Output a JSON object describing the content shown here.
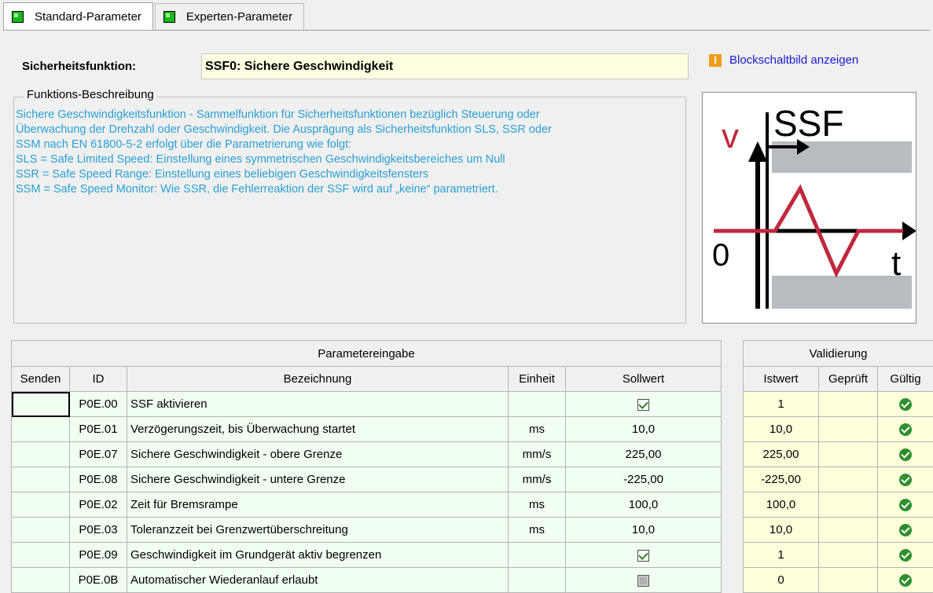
{
  "tabs": [
    {
      "label": "Standard-Parameter",
      "active": true
    },
    {
      "label": "Experten-Parameter",
      "active": false
    }
  ],
  "safety_function": {
    "label": "Sicherheitsfunktion:",
    "value": "SSF0: Sichere Geschwindigkeit"
  },
  "block_diagram_link": {
    "icon": "info-icon",
    "label": "Blockschaltbild anzeigen"
  },
  "description": {
    "legend": "Funktions-Beschreibung",
    "lines": [
      "Sichere Geschwindigkeitsfunktion - Sammelfunktion für Sicherheitsfunktionen bezüglich Steuerung oder",
      "Überwachung der Drehzahl oder Geschwindigkeit. Die Ausprägung als Sicherheitsfunktion SLS, SSR oder",
      "SSM nach EN 61800-5-2 erfolgt über die Parametrierung wie folgt:",
      "SLS = Safe Limited Speed:   Einstellung eines symmetrischen Geschwindigkeitsbereiches um Null",
      "SSR = Safe Speed Range: Einstellung eines beliebigen Geschwindigkeitsfensters",
      "SSM = Safe Speed Monitor: Wie SSR, die Fehlerreaktion der SSF wird auf „keine“ parametriert."
    ]
  },
  "diagram": {
    "title": "SSF",
    "v_label": "v",
    "zero_label": "0",
    "t_label": "t",
    "colors": {
      "signal": "#c0283c",
      "band": "#b8bcc0",
      "axis": "#000000"
    }
  },
  "table": {
    "group_input": "Parametereingabe",
    "group_validation": "Validierung",
    "columns": {
      "send": "Senden",
      "id": "ID",
      "name": "Bezeichnung",
      "unit": "Einheit",
      "setpoint": "Sollwert",
      "actual": "Istwert",
      "checked": "Geprüft",
      "valid": "Gültig"
    },
    "rows": [
      {
        "id": "P0E.00",
        "name": "SSF aktivieren",
        "unit": "",
        "setpoint": "",
        "setpoint_checkbox": "checked",
        "actual": "1",
        "valid": true
      },
      {
        "id": "P0E.01",
        "name": "Verzögerungszeit, bis Überwachung startet",
        "unit": "ms",
        "setpoint": "10,0",
        "setpoint_checkbox": "",
        "actual": "10,0",
        "valid": true
      },
      {
        "id": "P0E.07",
        "name": "Sichere Geschwindigkeit - obere Grenze",
        "unit": "mm/s",
        "setpoint": "225,00",
        "setpoint_checkbox": "",
        "actual": "225,00",
        "valid": true
      },
      {
        "id": "P0E.08",
        "name": "Sichere Geschwindigkeit - untere Grenze",
        "unit": "mm/s",
        "setpoint": "-225,00",
        "setpoint_checkbox": "",
        "actual": "-225,00",
        "valid": true
      },
      {
        "id": "P0E.02",
        "name": "Zeit für Bremsrampe",
        "unit": "ms",
        "setpoint": "100,0",
        "setpoint_checkbox": "",
        "actual": "100,0",
        "valid": true
      },
      {
        "id": "P0E.03",
        "name": "Toleranzzeit bei Grenzwertüberschreitung",
        "unit": "ms",
        "setpoint": "10,0",
        "setpoint_checkbox": "",
        "actual": "10,0",
        "valid": true
      },
      {
        "id": "P0E.09",
        "name": "Geschwindigkeit im Grundgerät aktiv begrenzen",
        "unit": "",
        "setpoint": "",
        "setpoint_checkbox": "checked",
        "actual": "1",
        "valid": true
      },
      {
        "id": "P0E.0B",
        "name": "Automatischer Wiederanlauf erlaubt",
        "unit": "",
        "setpoint": "",
        "setpoint_checkbox": "unchecked",
        "actual": "0",
        "valid": true
      }
    ]
  }
}
